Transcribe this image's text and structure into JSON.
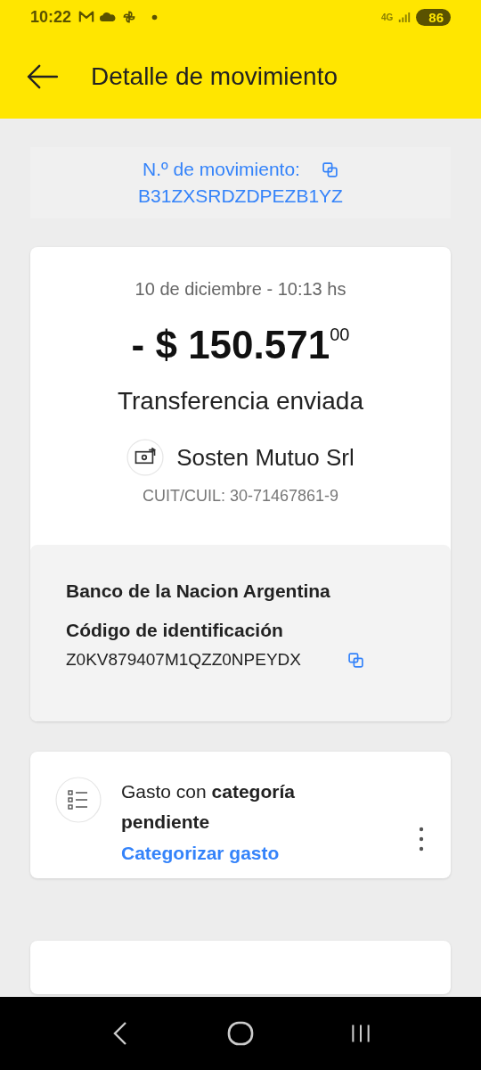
{
  "status_bar": {
    "time": "10:22",
    "network": "4G",
    "battery": "86"
  },
  "header": {
    "title": "Detalle de movimiento"
  },
  "movement": {
    "label": "N.º de movimiento:",
    "number": "B31ZXSRDZDPEZB1YZ"
  },
  "detail": {
    "date": "10 de diciembre - 10:13 hs",
    "amount": "- $ 150.571",
    "cents": "00",
    "type": "Transferencia enviada",
    "recipient": "Sosten Mutuo Srl",
    "tax_id": "CUIT/CUIL: 30-71467861-9",
    "bank": {
      "name": "Banco de la Nacion Argentina",
      "code_label": "Código de identificación",
      "code": "Z0KV879407M1QZZ0NPEYDX"
    }
  },
  "category": {
    "text": "Gasto con **categoría pendiente**",
    "action": "Categorizar gasto"
  }
}
